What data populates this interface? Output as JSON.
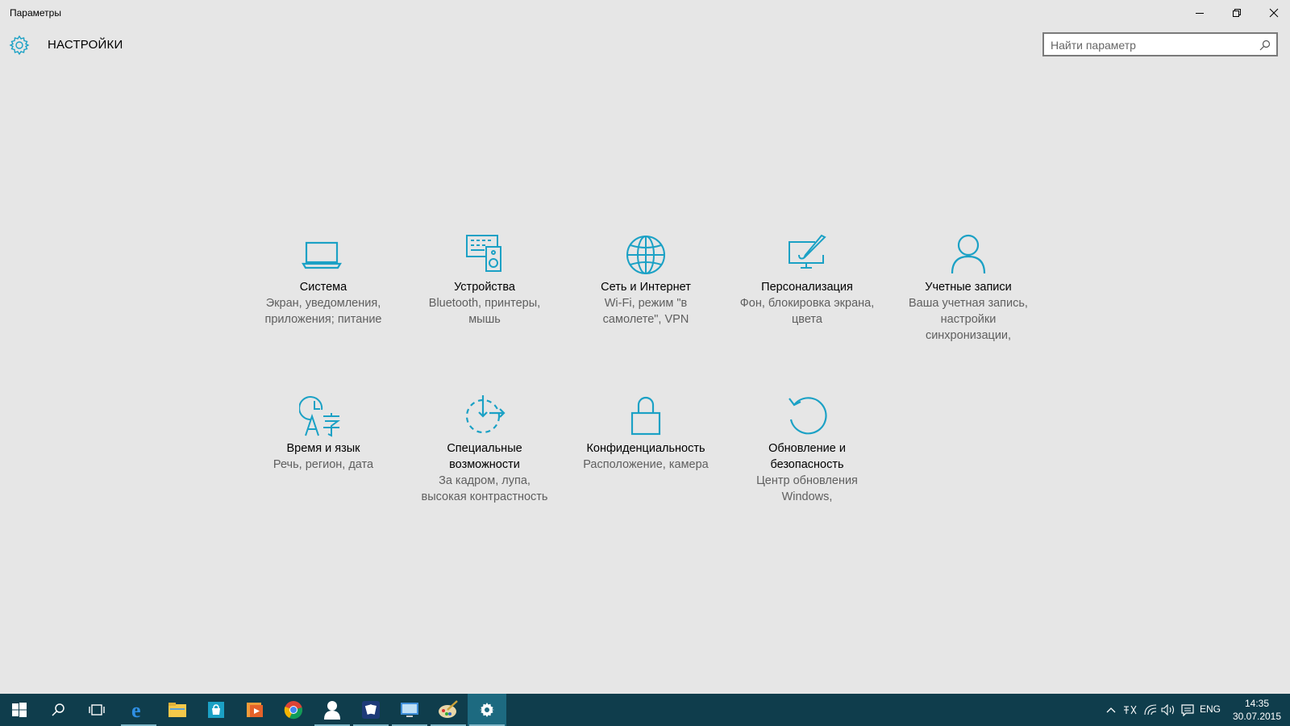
{
  "window": {
    "title": "Параметры",
    "controls": {
      "minimize": "minimize",
      "restore": "restore",
      "close": "close"
    }
  },
  "header": {
    "title": "НАСТРОЙКИ",
    "search_placeholder": "Найти параметр"
  },
  "accent_color": "#1ba1c5",
  "categories": [
    {
      "icon": "laptop-icon",
      "name": "Система",
      "desc": "Экран, уведомления, приложения; питание"
    },
    {
      "icon": "devices-icon",
      "name": "Устройства",
      "desc": "Bluetooth, принтеры, мышь"
    },
    {
      "icon": "globe-icon",
      "name": "Сеть и Интернет",
      "desc": "Wi-Fi, режим \"в самолете\", VPN"
    },
    {
      "icon": "personalization-icon",
      "name": "Персонализация",
      "desc": "Фон, блокировка экрана, цвета"
    },
    {
      "icon": "person-icon",
      "name": "Учетные записи",
      "desc": "Ваша учетная запись, настройки синхронизации,"
    },
    {
      "icon": "time-language-icon",
      "name": "Время и язык",
      "desc": "Речь, регион, дата"
    },
    {
      "icon": "accessibility-icon",
      "name": "Специальные возможности",
      "desc": "За кадром, лупа, высокая контрастность"
    },
    {
      "icon": "lock-icon",
      "name": "Конфиденциальность",
      "desc": "Расположение, камера"
    },
    {
      "icon": "update-icon",
      "name": "Обновление и безопасность",
      "desc": "Центр обновления Windows,"
    }
  ],
  "taskbar": {
    "apps": [
      "start-icon",
      "search-icon",
      "task-view-icon",
      "edge-icon",
      "file-explorer-icon",
      "store-icon",
      "media-player-icon",
      "chrome-icon",
      "people-icon",
      "solitaire-icon",
      "remote-desktop-icon",
      "paint-icon",
      "settings-icon"
    ],
    "language": "ENG",
    "time": "14:35",
    "date": "30.07.2015"
  }
}
